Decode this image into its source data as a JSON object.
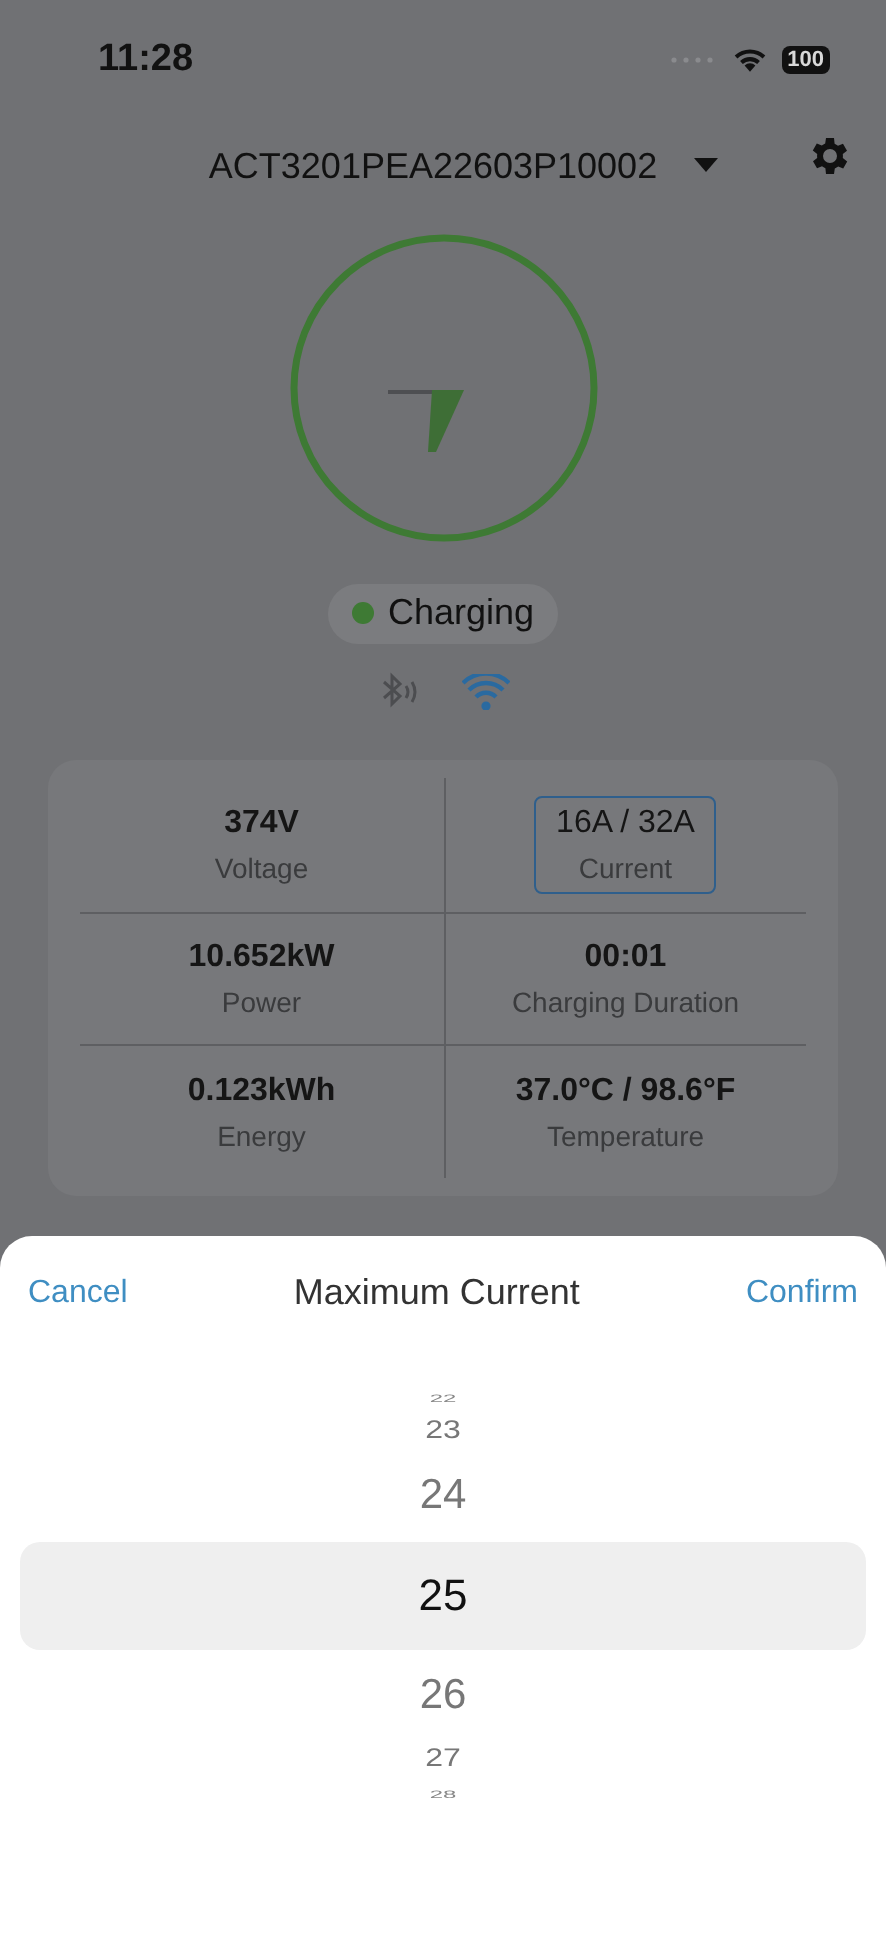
{
  "status_bar": {
    "time": "11:28",
    "battery": "100"
  },
  "header": {
    "device_name": "ACT3201PEA22603P10002"
  },
  "charger": {
    "status": "Charging",
    "bluetooth_connected": false,
    "wifi_connected": true
  },
  "stats": [
    {
      "value": "374V",
      "label": "Voltage",
      "outlined": false
    },
    {
      "value": "16A / 32A",
      "label": "Current",
      "outlined": true
    },
    {
      "value": "10.652kW",
      "label": "Power",
      "outlined": false
    },
    {
      "value": "00:01",
      "label": "Charging Duration",
      "outlined": false
    },
    {
      "value": "0.123kWh",
      "label": "Energy",
      "outlined": false
    },
    {
      "value": "37.0°C / 98.6°F",
      "label": "Temperature",
      "outlined": false
    }
  ],
  "sheet": {
    "cancel": "Cancel",
    "title": "Maximum Current",
    "confirm": "Confirm",
    "picker": [
      {
        "value": "22",
        "selected": false
      },
      {
        "value": "23",
        "selected": false
      },
      {
        "value": "24",
        "selected": false
      },
      {
        "value": "25",
        "selected": true
      },
      {
        "value": "26",
        "selected": false
      },
      {
        "value": "27",
        "selected": false
      },
      {
        "value": "28",
        "selected": false
      }
    ]
  }
}
